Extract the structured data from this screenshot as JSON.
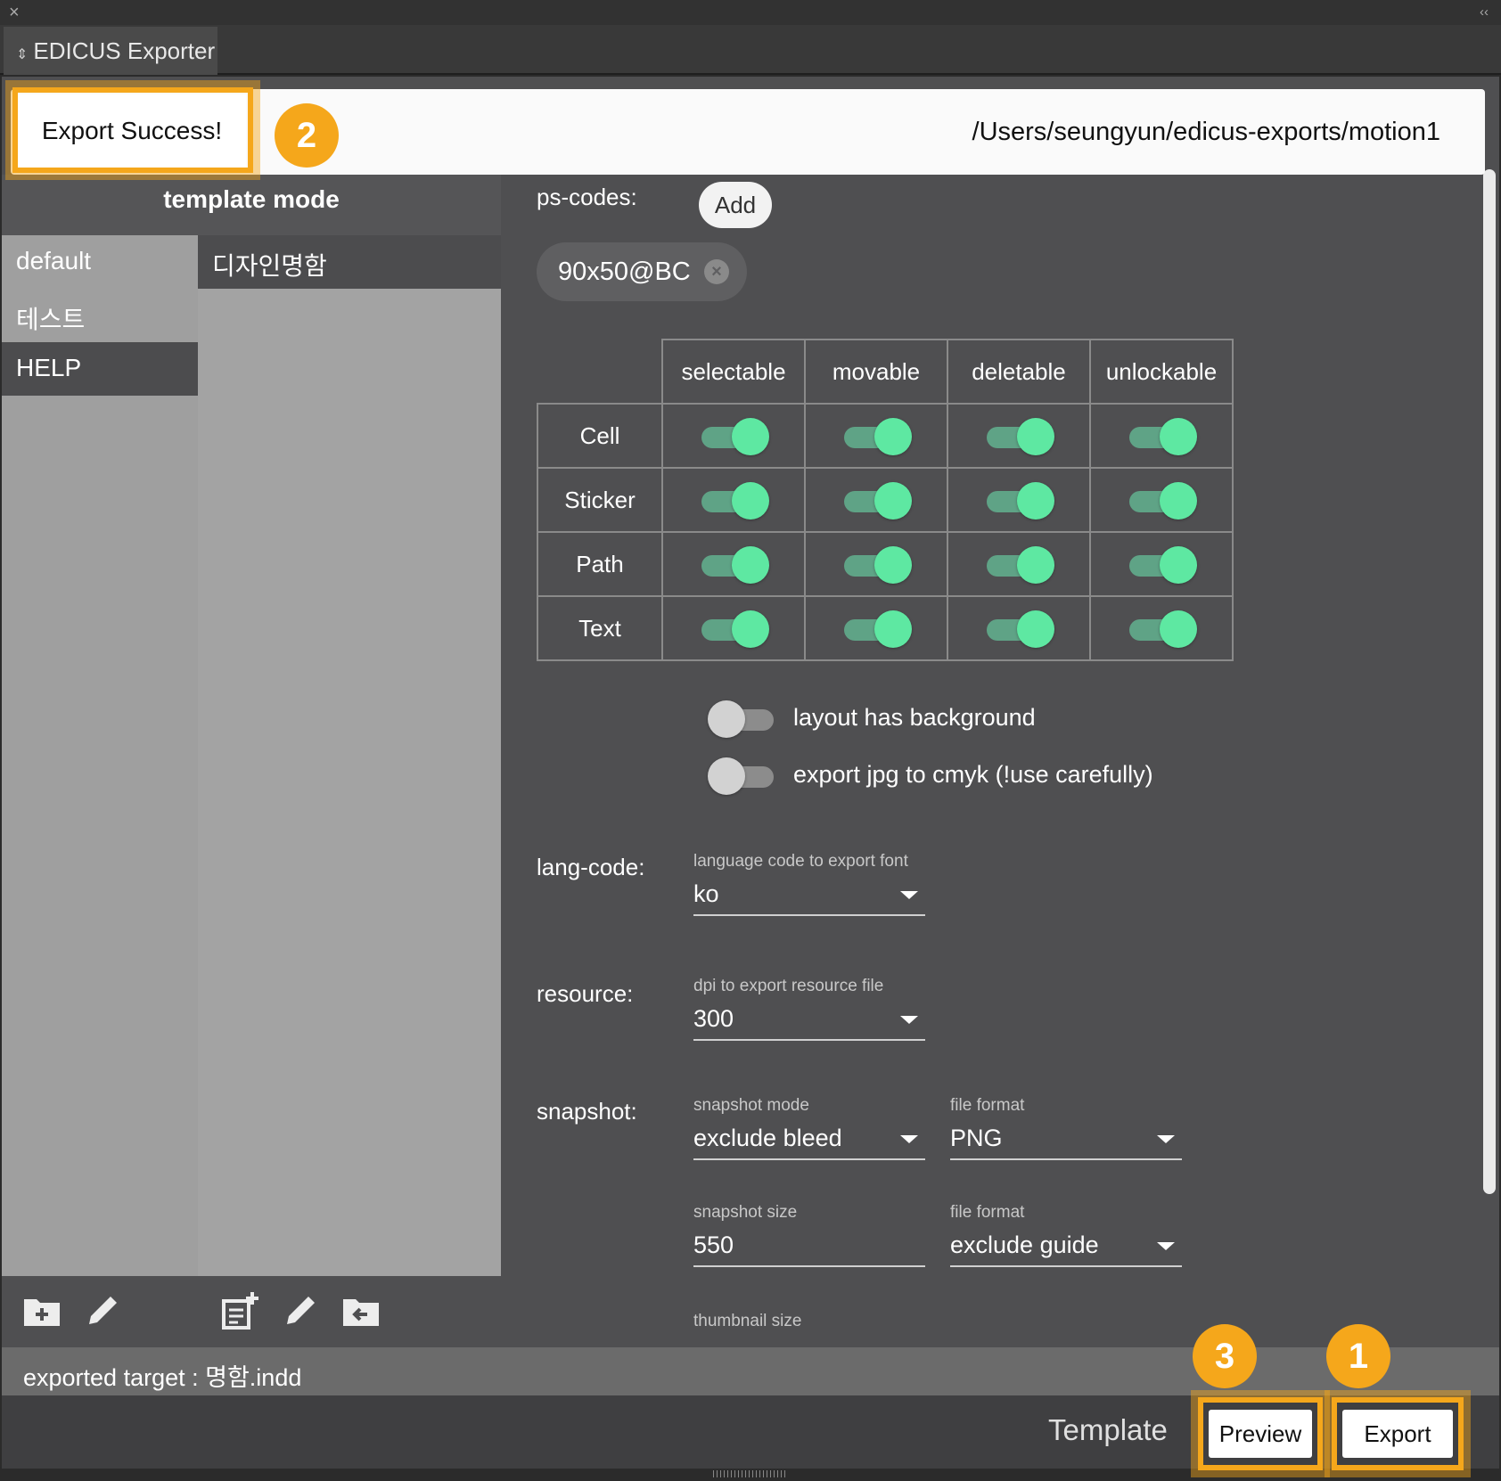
{
  "window": {
    "tab_title": "EDICUS Exporter",
    "close_glyph": "×",
    "collapse_glyph": "‹‹",
    "tab_arrows": "⇕"
  },
  "notice": {
    "message": "Export Success!",
    "path": "/Users/seungyun/edicus-exports/motion1"
  },
  "badges": {
    "b1": "1",
    "b2": "2",
    "b3": "3"
  },
  "left": {
    "title": "template mode",
    "categories": [
      "default",
      "테스트",
      "HELP"
    ],
    "selected_category": "HELP",
    "templates": [
      "디자인명함"
    ],
    "tools": [
      "folder-add-icon",
      "pencil-icon",
      "document-add-icon",
      "pencil-icon",
      "folder-import-icon"
    ]
  },
  "ps_codes": {
    "label": "ps-codes:",
    "add_label": "Add",
    "chips": [
      "90x50@BC"
    ]
  },
  "permissions": {
    "columns": [
      "selectable",
      "movable",
      "deletable",
      "unlockable"
    ],
    "rows": [
      {
        "name": "Cell",
        "values": [
          true,
          true,
          true,
          true
        ]
      },
      {
        "name": "Sticker",
        "values": [
          true,
          true,
          true,
          true
        ]
      },
      {
        "name": "Path",
        "values": [
          true,
          true,
          true,
          true
        ]
      },
      {
        "name": "Text",
        "values": [
          true,
          true,
          true,
          true
        ]
      }
    ]
  },
  "options": {
    "layout_bg": {
      "label": "layout has background",
      "on": false
    },
    "cmyk": {
      "label": "export jpg to cmyk (!use carefully)",
      "on": false
    }
  },
  "lang": {
    "label": "lang-code:",
    "hint": "language code to export font",
    "value": "ko"
  },
  "resource": {
    "label": "resource:",
    "hint": "dpi to export resource file",
    "value": "300"
  },
  "snapshot": {
    "label": "snapshot:",
    "mode_hint": "snapshot mode",
    "mode_value": "exclude bleed",
    "format_hint": "file format",
    "format_value": "PNG",
    "size_hint": "snapshot size",
    "size_value": "550",
    "format2_hint": "file format",
    "format2_value": "exclude guide",
    "thumb_hint": "thumbnail size"
  },
  "status": {
    "text": "exported target : 명함.indd"
  },
  "footer": {
    "template_label": "Template",
    "preview_label": "Preview",
    "export_label": "Export"
  },
  "colors": {
    "accent": "#f5a71b",
    "toggle_on": "#5ee8a2",
    "panel": "#4f4f51"
  }
}
